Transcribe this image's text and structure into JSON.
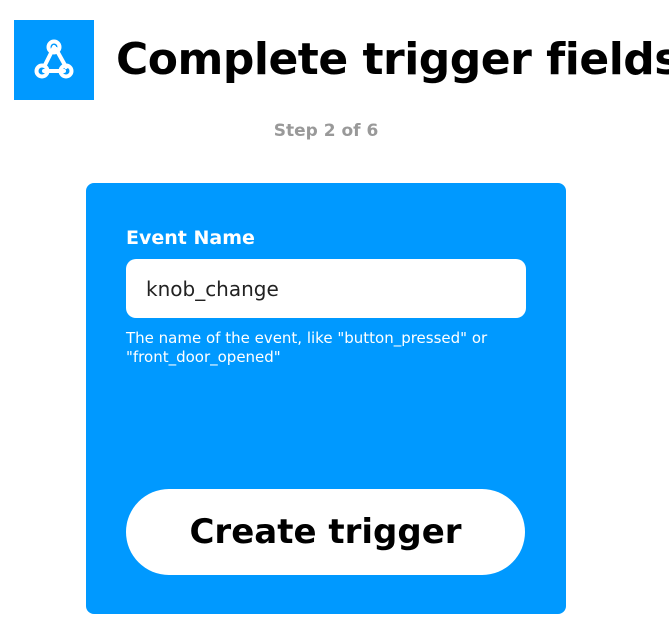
{
  "header": {
    "service_icon": "webhooks-icon",
    "title": "Complete trigger fields"
  },
  "step": {
    "label": "Step 2 of 6"
  },
  "form": {
    "event_name_label": "Event Name",
    "event_name_value": "knob_change",
    "event_name_help": "The name of the event, like \"button_pressed\" or \"front_door_opened\"",
    "submit_label": "Create trigger"
  },
  "colors": {
    "accent": "#0099ff",
    "step_text": "#999999",
    "title_text": "#000000"
  }
}
